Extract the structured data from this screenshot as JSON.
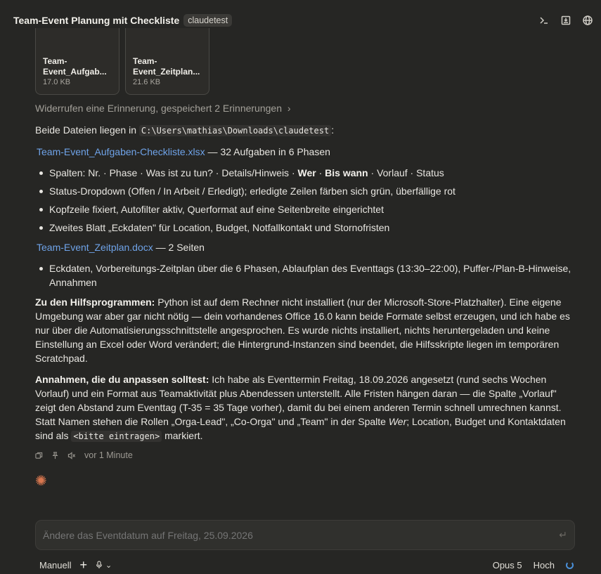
{
  "header": {
    "title": "Team-Event Planung mit Checkliste",
    "badge": "claudetest",
    "icons": [
      "terminal-icon",
      "archive-icon",
      "globe-icon"
    ]
  },
  "files": [
    {
      "name_line1": "Team-",
      "name_line2": "Event_Aufgab...",
      "size": "17.0 KB"
    },
    {
      "name_line1": "Team-",
      "name_line2": "Event_Zeitplan...",
      "size": "21.6 KB"
    }
  ],
  "message": {
    "memory": "Widerrufen eine Erinnerung, gespeichert 2 Erinnerungen",
    "intro_a": "Beide Dateien liegen in ",
    "intro_path": "C:\\Users\\mathias\\Downloads\\claudetest",
    "intro_b": ":",
    "file1_link": "Team-Event_Aufgaben-Checkliste.xlsx",
    "file1_desc": " — 32 Aufgaben in 6 Phasen",
    "file1_bullets": {
      "b1_a": "Spalten: Nr. · Phase · Was ist zu tun? · Details/Hinweis · ",
      "b1_wer": "Wer",
      "b1_sep": " · ",
      "b1_bis": "Bis wann",
      "b1_b": " · Vorlauf · Status",
      "b2": "Status-Dropdown (Offen / In Arbeit / Erledigt); erledigte Zeilen färben sich grün, überfällige rot",
      "b3": "Kopfzeile fixiert, Autofilter aktiv, Querformat auf eine Seitenbreite eingerichtet",
      "b4": "Zweites Blatt „Eckdaten\" für Location, Budget, Notfallkontakt und Stornofristen"
    },
    "file2_link": "Team-Event_Zeitplan.docx",
    "file2_desc": " — 2 Seiten",
    "file2_bullet": "Eckdaten, Vorbereitungs-Zeitplan über die 6 Phasen, Ablaufplan des Eventtags (13:30–22:00), Puffer-/Plan-B-Hinweise, Annahmen",
    "tools_label": "Zu den Hilfsprogrammen:",
    "tools_text": " Python ist auf dem Rechner nicht installiert (nur der Microsoft-Store-Platzhalter). Eine eigene Umgebung war aber gar nicht nötig — dein vorhandenes Office 16.0 kann beide Formate selbst erzeugen, und ich habe es nur über die Automatisierungsschnittstelle angesprochen. Es wurde nichts installiert, nichts heruntergeladen und keine Einstellung an Excel oder Word verändert; die Hintergrund-Instanzen sind beendet, die Hilfsskripte liegen im temporären Scratchpad.",
    "assume_label": "Annahmen, die du anpassen solltest:",
    "assume_text_a": " Ich habe als Eventtermin Freitag, 18.09.2026 angesetzt (rund sechs Wochen Vorlauf) und ein Format aus Teamaktivität plus Abendessen unterstellt. Alle Fristen hängen daran — die Spalte „Vorlauf\" zeigt den Abstand zum Eventtag (T-35 = 35 Tage vorher), damit du bei einem anderen Termin schnell umrechnen kannst. Statt Namen stehen die Rollen „Orga-Lead\", „Co-Orga\" und „Team\" in der Spalte ",
    "assume_wer": "Wer",
    "assume_text_b": "; Location, Budget und Kontaktdaten sind als ",
    "assume_code": "<bitte eintragen>",
    "assume_text_c": " markiert.",
    "timestamp": "vor 1 Minute"
  },
  "input": {
    "placeholder": "Ändere das Eventdatum auf Freitag, 25.09.2026"
  },
  "footer": {
    "mode": "Manuell",
    "model": "Opus 5",
    "effort": "Hoch"
  },
  "colors": {
    "background": "#262624",
    "link": "#6fa3e8",
    "accent": "#d9774f"
  }
}
